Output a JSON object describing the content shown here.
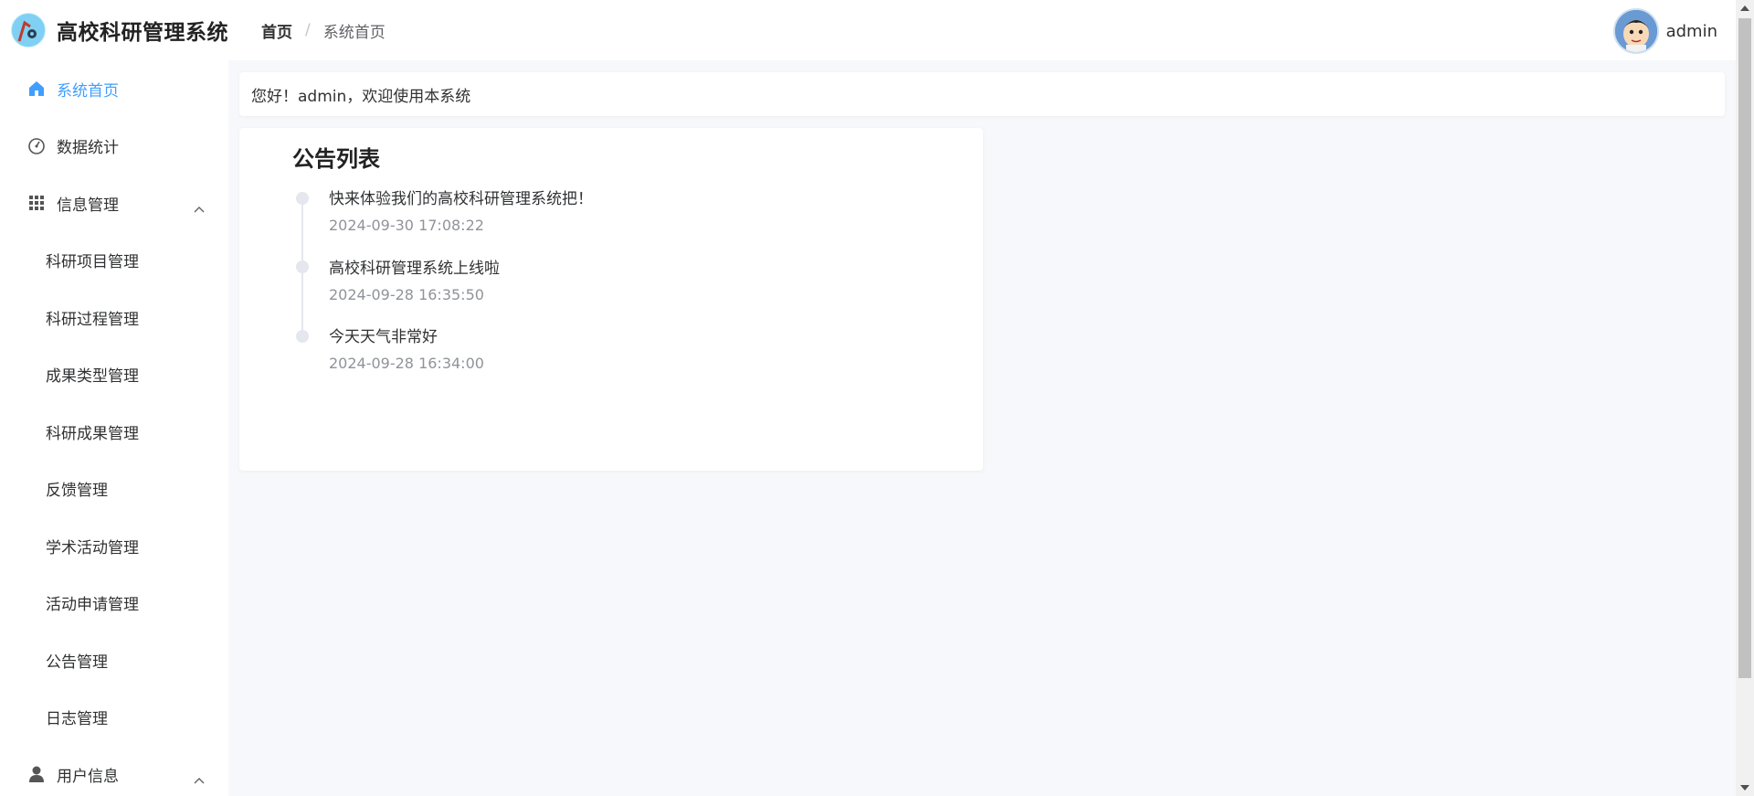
{
  "header": {
    "app_title": "高校科研管理系统",
    "breadcrumb": {
      "home": "首页",
      "separator": "/",
      "current": "系统首页"
    },
    "user": {
      "name": "admin"
    }
  },
  "sidebar": {
    "items": [
      {
        "label": "系统首页",
        "icon": "home-icon",
        "active": true
      },
      {
        "label": "数据统计",
        "icon": "gauge-icon"
      },
      {
        "label": "信息管理",
        "icon": "grid-icon",
        "expanded": true
      },
      {
        "label": "科研项目管理"
      },
      {
        "label": "科研过程管理"
      },
      {
        "label": "成果类型管理"
      },
      {
        "label": "科研成果管理"
      },
      {
        "label": "反馈管理"
      },
      {
        "label": "学术活动管理"
      },
      {
        "label": "活动申请管理"
      },
      {
        "label": "公告管理"
      },
      {
        "label": "日志管理"
      },
      {
        "label": "用户信息",
        "icon": "user-icon",
        "expanded": true
      }
    ]
  },
  "main": {
    "welcome": "您好！admin，欢迎使用本系统",
    "notice": {
      "title": "公告列表",
      "items": [
        {
          "text": "快来体验我们的高校科研管理系统把！",
          "time": "2024-09-30 17:08:22"
        },
        {
          "text": "高校科研管理系统上线啦",
          "time": "2024-09-28 16:35:50"
        },
        {
          "text": "今天天气非常好",
          "time": "2024-09-28 16:34:00"
        }
      ]
    }
  },
  "colors": {
    "accent": "#409eff",
    "page_bg": "#f7f8fb",
    "timeline_dot": "#e4e7ed"
  }
}
